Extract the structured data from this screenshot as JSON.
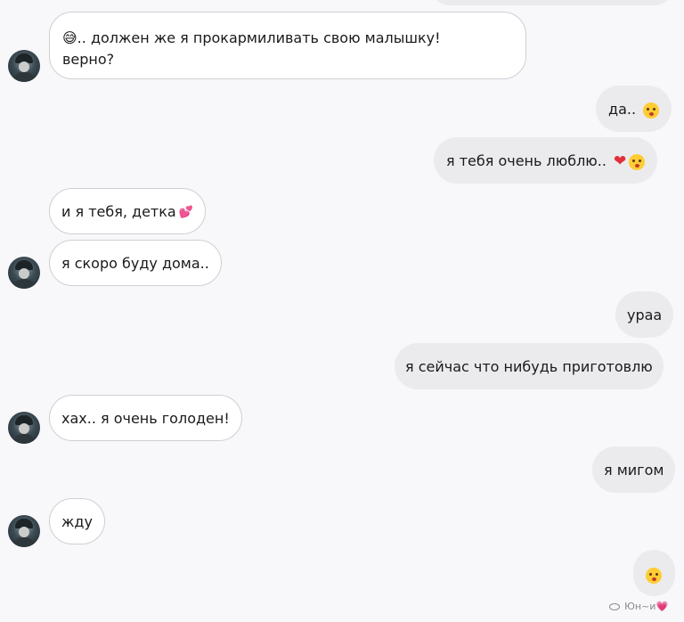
{
  "messages": [
    {
      "side": "in",
      "text": "😅.. должен же я прокармиливать свою малышку! верно?"
    },
    {
      "side": "out",
      "text": "да.."
    },
    {
      "side": "out",
      "text": "я тебя очень люблю.."
    },
    {
      "side": "in",
      "text": "и я тебя, детка"
    },
    {
      "side": "in",
      "text": "я скоро буду дома.."
    },
    {
      "side": "out",
      "text": "ураа"
    },
    {
      "side": "out",
      "text": "я сейчас что нибудь приготовлю"
    },
    {
      "side": "in",
      "text": "хах.. я очень голоден!"
    },
    {
      "side": "out",
      "text": "я мигом"
    },
    {
      "side": "in",
      "text": "жду"
    }
  ],
  "msg1_line1": "😅.. должен же я прокармиливать свою малышку!",
  "msg1_line2": "верно?",
  "seen_label": "Юн~и",
  "icons": {
    "kiss_face": "kissing-face-icon",
    "heart": "red-heart-icon",
    "two_hearts": "two-hearts-icon",
    "seen_eye": "eye-icon"
  },
  "colors": {
    "background": "#f8f7fa",
    "incoming_bubble": "#ffffff",
    "outgoing_bubble": "#ebebee"
  }
}
